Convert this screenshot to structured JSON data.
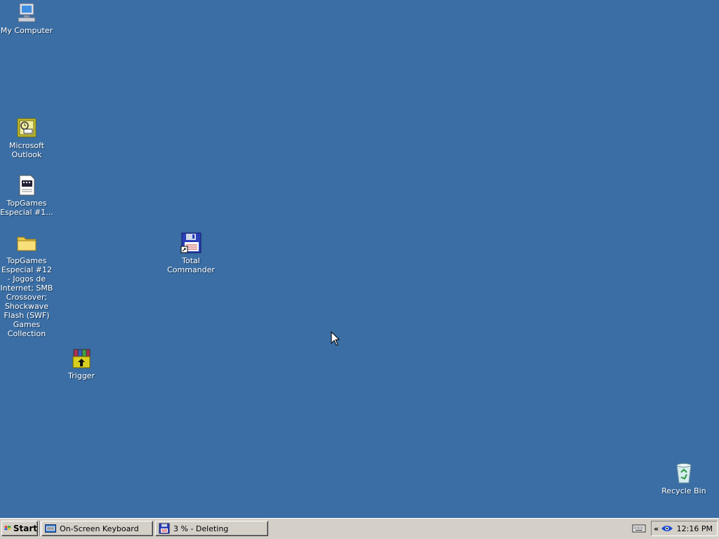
{
  "desktop": {
    "background": "#3a6ea5",
    "icons": [
      {
        "label": "My Computer",
        "icon": "my-computer-icon"
      },
      {
        "label": "Microsoft Outlook",
        "icon": "outlook-icon"
      },
      {
        "label": "TopGames Especial #1...",
        "icon": "document-icon"
      },
      {
        "label": "TopGames Especial #12 - Jogos de Internet; SMB Crossover; Shockwave Flash (SWF) Games Collection",
        "icon": "folder-icon"
      },
      {
        "label": "Total Commander",
        "icon": "floppy-shortcut-icon"
      },
      {
        "label": "Trigger",
        "icon": "winrar-archive-icon"
      },
      {
        "label": "Recycle Bin",
        "icon": "recycle-bin-icon"
      }
    ]
  },
  "taskbar": {
    "start_label": "Start",
    "tasks": [
      {
        "label": "On-Screen Keyboard",
        "icon": "keyboard-app-icon"
      },
      {
        "label": "3 % - Deleting",
        "icon": "floppy-icon"
      }
    ],
    "tray": {
      "expand_glyph": "«",
      "clock": "12:16 PM"
    }
  }
}
